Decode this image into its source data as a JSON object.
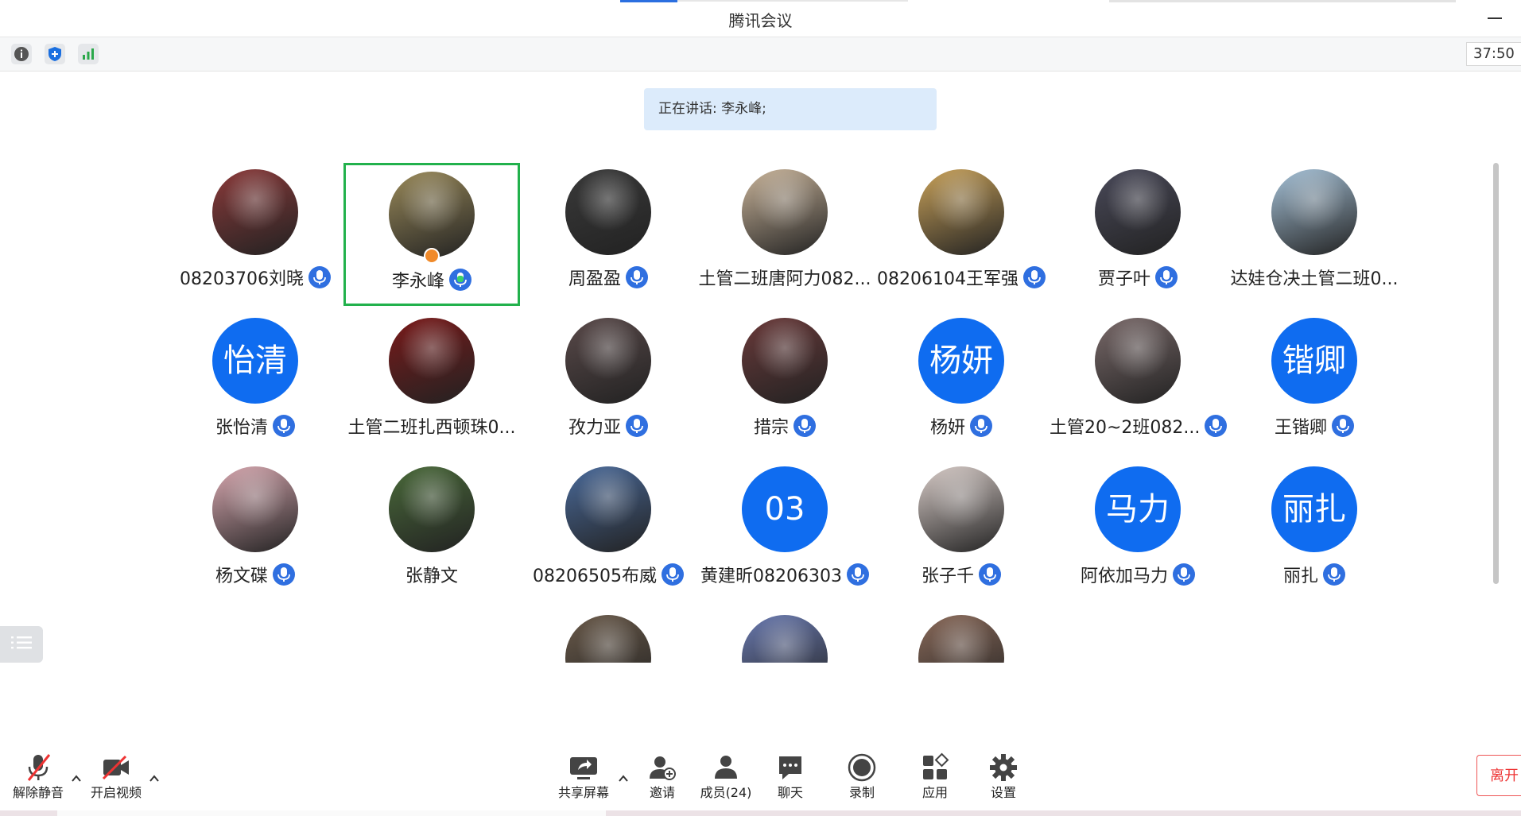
{
  "window": {
    "title": "腾讯会议"
  },
  "infobar": {
    "icons": [
      "info-icon",
      "shield-icon",
      "signal-icon"
    ],
    "timer": "37:50"
  },
  "speaking_banner": "正在讲话: 李永峰;",
  "participants": [
    {
      "name": "08203706刘晓",
      "avatar_type": "photo",
      "avatar_text": "",
      "color": "#8b3a3a",
      "mic": "muted"
    },
    {
      "name": "李永峰",
      "avatar_type": "photo",
      "avatar_text": "",
      "color": "#9a8a5a",
      "mic": "speaking",
      "active": true,
      "host": true
    },
    {
      "name": "周盈盈",
      "avatar_type": "photo",
      "avatar_text": "",
      "color": "#3a3a3a",
      "mic": "muted"
    },
    {
      "name": "土管二班唐阿力082...",
      "avatar_type": "photo",
      "avatar_text": "",
      "color": "#c9b49a",
      "mic": "none"
    },
    {
      "name": "08206104王军强",
      "avatar_type": "photo",
      "avatar_text": "",
      "color": "#c9a25a",
      "mic": "muted"
    },
    {
      "name": "贾子叶",
      "avatar_type": "photo",
      "avatar_text": "",
      "color": "#4a4a5a",
      "mic": "muted"
    },
    {
      "name": "达娃仓决土管二班0...",
      "avatar_type": "photo",
      "avatar_text": "",
      "color": "#a6c2d8",
      "mic": "none"
    },
    {
      "name": "张怡清",
      "avatar_type": "text",
      "avatar_text": "怡清",
      "color": "#0f6cf0",
      "mic": "muted"
    },
    {
      "name": "土管二班扎西顿珠0...",
      "avatar_type": "photo",
      "avatar_text": "",
      "color": "#7a1a1a",
      "mic": "none"
    },
    {
      "name": "孜力亚",
      "avatar_type": "photo",
      "avatar_text": "",
      "color": "#5a4a4a",
      "mic": "muted"
    },
    {
      "name": "措宗",
      "avatar_type": "photo",
      "avatar_text": "",
      "color": "#6a3a3a",
      "mic": "muted"
    },
    {
      "name": "杨妍",
      "avatar_type": "text",
      "avatar_text": "杨妍",
      "color": "#0f6cf0",
      "mic": "muted"
    },
    {
      "name": "土管20~2班082...",
      "avatar_type": "photo",
      "avatar_text": "",
      "color": "#7a6a6a",
      "mic": "muted"
    },
    {
      "name": "王锴卿",
      "avatar_type": "text",
      "avatar_text": "锴卿",
      "color": "#0f6cf0",
      "mic": "muted"
    },
    {
      "name": "杨文碟",
      "avatar_type": "photo",
      "avatar_text": "",
      "color": "#d8a8b0",
      "mic": "muted"
    },
    {
      "name": "张静文",
      "avatar_type": "photo",
      "avatar_text": "",
      "color": "#4a6a3a",
      "mic": "none"
    },
    {
      "name": "08206505布威",
      "avatar_type": "photo",
      "avatar_text": "",
      "color": "#4a6a9a",
      "mic": "muted"
    },
    {
      "name": "黄建昕08206303",
      "avatar_type": "text",
      "avatar_text": "03",
      "color": "#0f6cf0",
      "mic": "muted"
    },
    {
      "name": "张子千",
      "avatar_type": "photo",
      "avatar_text": "",
      "color": "#d8ccc8",
      "mic": "muted"
    },
    {
      "name": "阿依加马力",
      "avatar_type": "text",
      "avatar_text": "马力",
      "color": "#0f6cf0",
      "mic": "muted"
    },
    {
      "name": "丽扎",
      "avatar_type": "text",
      "avatar_text": "丽扎",
      "color": "#0f6cf0",
      "mic": "muted"
    },
    {
      "name": "",
      "avatar_type": "photo",
      "avatar_text": "",
      "color": "#6a5a4a",
      "mic": "none",
      "partial": true
    },
    {
      "name": "",
      "avatar_type": "photo",
      "avatar_text": "",
      "color": "#6a7ab0",
      "mic": "none",
      "partial": true
    },
    {
      "name": "",
      "avatar_type": "photo",
      "avatar_text": "",
      "color": "#8a6a5a",
      "mic": "none",
      "partial": true
    }
  ],
  "toolbar": {
    "unmute": "解除静音",
    "video": "开启视频",
    "share": "共享屏幕",
    "invite": "邀请",
    "members": "成员(24)",
    "chat": "聊天",
    "record": "录制",
    "apps": "应用",
    "settings": "设置",
    "leave": "离开"
  }
}
